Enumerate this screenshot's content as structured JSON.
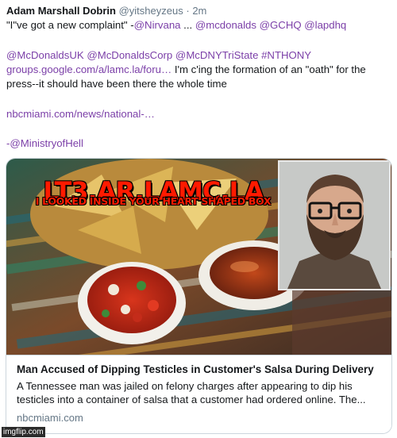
{
  "tweet": {
    "author_name": "Adam Marshall Dobrin",
    "handle": "@yitsheyzeus",
    "separator": "·",
    "time": "2m",
    "line1_quote": "\"I\"ve got a new complaint\" -",
    "line1_link1": "@Nirvana",
    "line1_mid": " ... ",
    "line1_link2": "@mcdonalds @GCHQ @lapdhq",
    "line2_links": "@McDonaldsUK @McDonaldsCorp @McDNYTriState #NTHONY",
    "line3_link": "groups.google.com/a/lamc.la/foru…",
    "line3_text": " I'm c'ing the formation of an \"oath\" for the",
    "line4_text": "press--it should have been there the whole time",
    "line5_link": "nbcmiami.com/news/national-…",
    "line6_link": "-@MinistryofHell"
  },
  "card": {
    "meme_title": "LT3.AR.LAMC.LA",
    "meme_subtitle": "I LOOKED INSIDE YOUR HEART SHAPED BOX",
    "title": "Man Accused of Dipping Testicles in Customer's Salsa During Delivery",
    "description": "A Tennessee man was jailed on felony charges after appearing to dip his testicles into a container of salsa that a customer had ordered online. The...",
    "domain": "nbcmiami.com"
  },
  "watermark": "imgflip.com",
  "colors": {
    "link": "#7b3fa8",
    "meme_text": "#ff1a00",
    "meta_gray": "#657786",
    "border": "#ccd6dd"
  }
}
